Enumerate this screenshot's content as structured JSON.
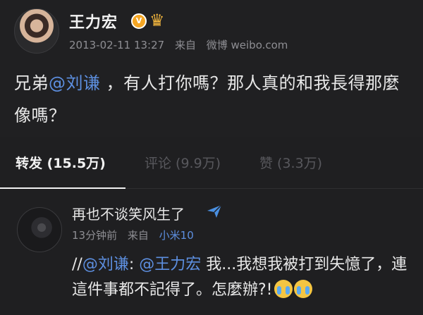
{
  "post": {
    "author": "王力宏",
    "verified_badge": "V",
    "crown_icon": "crown-icon",
    "date": "2013-02-11 13:27",
    "from_label": "来自",
    "source": "微博 weibo.com",
    "text_prefix": "兄弟",
    "mention": "@刘谦",
    "text_suffix": " ，有人打你嗎？那人真的和我長得那麼像嗎？"
  },
  "tabs": [
    {
      "label": "转发 (15.5万)",
      "active": true
    },
    {
      "label": "评论 (9.9万)",
      "active": false
    },
    {
      "label": "赞 (3.3万)",
      "active": false
    }
  ],
  "repost": {
    "author": "再也不谈笑风生了",
    "time": "13分钟前",
    "from_label": "来自",
    "source": "小米10",
    "text_lead": "//",
    "mention1": "@刘谦",
    "colon": ": ",
    "mention2": "@王力宏",
    "text": " 我...我想我被打到失憶了，連這件事都不記得了。怎麼辦?!"
  },
  "colors": {
    "background": "#1f1f21",
    "link": "#5d8fe0",
    "meta": "#8e8e93",
    "verified": "#f5a623"
  }
}
